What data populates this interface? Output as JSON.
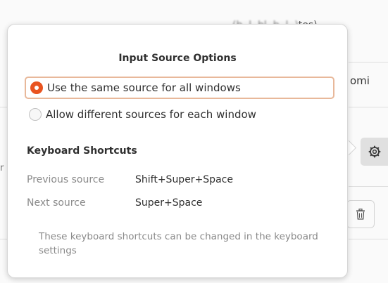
{
  "background": {
    "top_text_visible": "tes)",
    "top_text_blurred": "(b..l..bl..b..l..)",
    "mid_text": "omi",
    "left_edge_text": "r"
  },
  "icons": {
    "gear": "gear-icon",
    "trash": "trash-icon"
  },
  "popover": {
    "title": "Input Source Options",
    "options": [
      {
        "label": "Use the same source for all windows",
        "selected": true
      },
      {
        "label": "Allow different sources for each window",
        "selected": false
      }
    ],
    "shortcuts_title": "Keyboard Shortcuts",
    "shortcuts": [
      {
        "label": "Previous source",
        "value": "Shift+Super+Space"
      },
      {
        "label": "Next source",
        "value": "Super+Space"
      }
    ],
    "note": "These keyboard shortcuts can be changed in the keyboard settings"
  },
  "colors": {
    "accent": "#e95420",
    "selection_border": "#e8b89a"
  }
}
